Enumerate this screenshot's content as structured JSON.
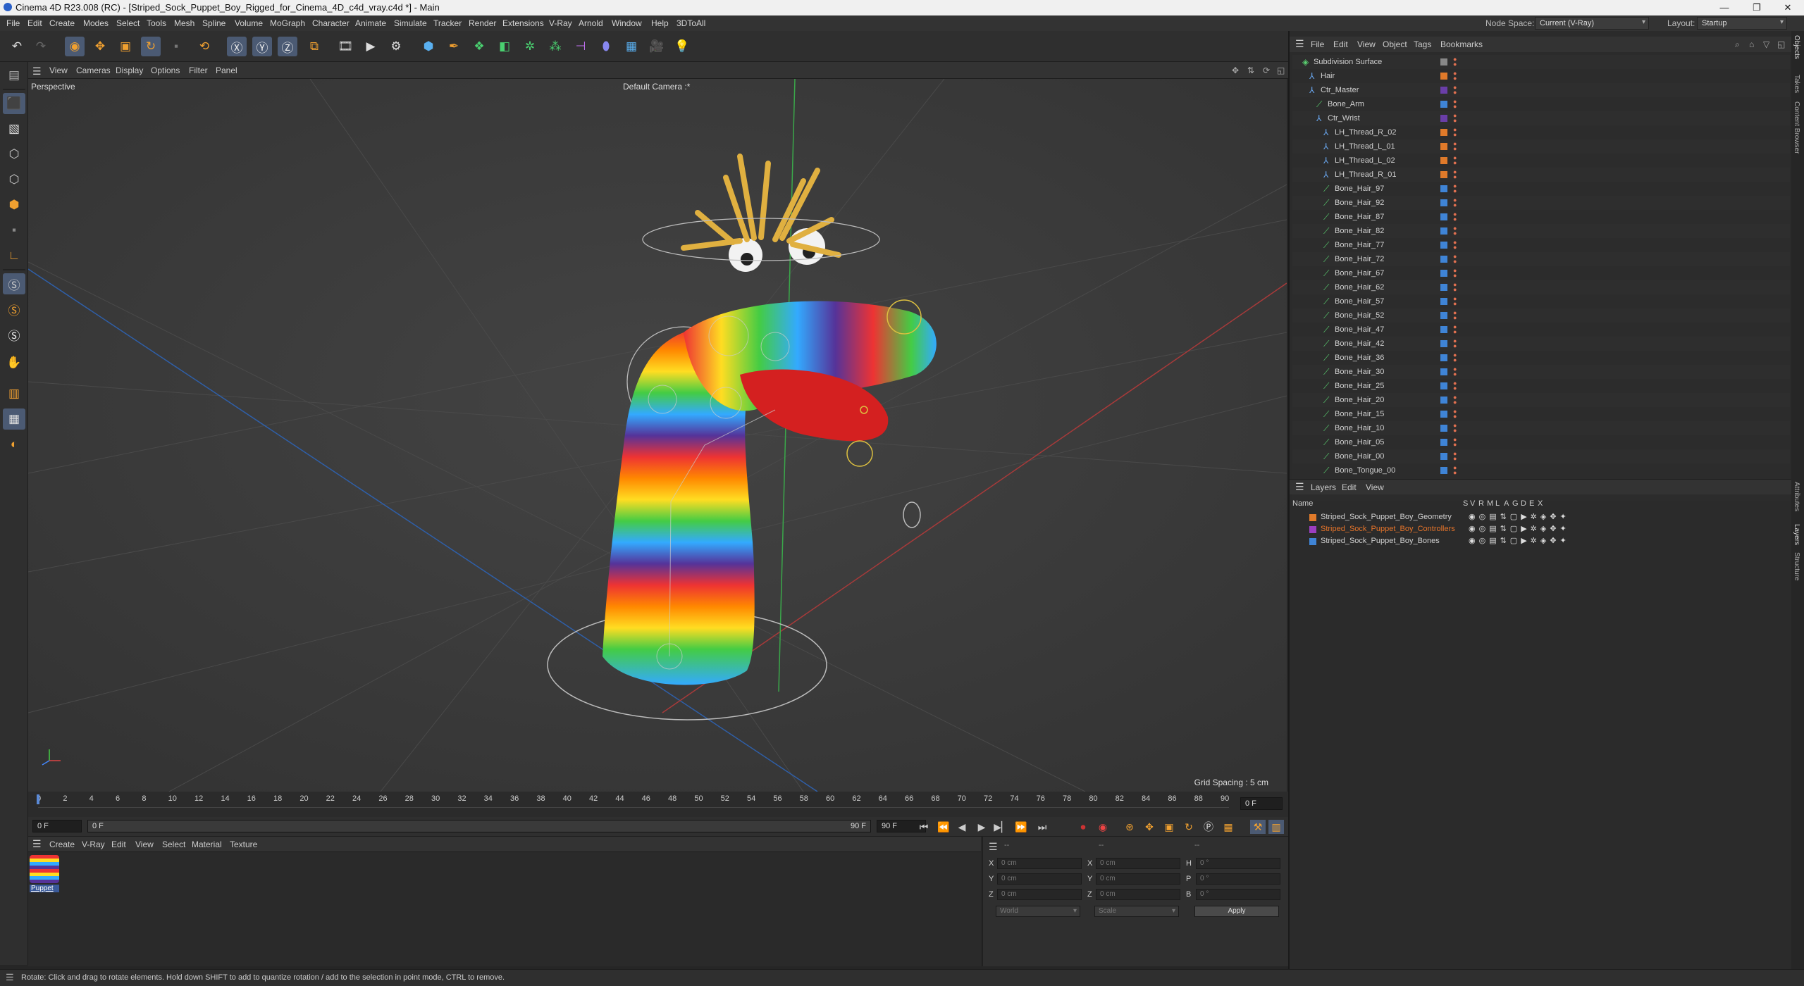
{
  "window": {
    "title": "Cinema 4D R23.008 (RC) - [Striped_Sock_Puppet_Boy_Rigged_for_Cinema_4D_c4d_vray.c4d *] - Main",
    "controls": [
      "—",
      "❐",
      "✕"
    ]
  },
  "menubar": {
    "items": [
      "File",
      "Edit",
      "Create",
      "Modes",
      "Select",
      "Tools",
      "Mesh",
      "Spline",
      "Volume",
      "MoGraph",
      "Character",
      "Animate",
      "Simulate",
      "Tracker",
      "Render",
      "Extensions",
      "V-Ray",
      "Arnold",
      "Window",
      "Help",
      "3DToAll"
    ],
    "node_space_label": "Node Space:",
    "node_space_value": "Current (V-Ray)",
    "layout_label": "Layout:",
    "layout_value": "Startup"
  },
  "viewport": {
    "menu": [
      "View",
      "Cameras",
      "Display",
      "Options",
      "Filter",
      "Panel"
    ],
    "label": "Perspective",
    "camera": "Default Camera :*",
    "grid_spacing": "Grid Spacing : 5 cm"
  },
  "timeline": {
    "ticks": [
      "0",
      "2",
      "4",
      "6",
      "8",
      "10",
      "12",
      "14",
      "16",
      "18",
      "20",
      "22",
      "24",
      "26",
      "28",
      "30",
      "32",
      "34",
      "36",
      "38",
      "40",
      "42",
      "44",
      "46",
      "48",
      "50",
      "52",
      "54",
      "56",
      "58",
      "60",
      "62",
      "64",
      "66",
      "68",
      "70",
      "72",
      "74",
      "76",
      "78",
      "80",
      "82",
      "84",
      "86",
      "88",
      "90"
    ],
    "current_frame": "0 F",
    "start_field": "0 F",
    "range_start": "0 F",
    "range_end": "90 F",
    "end_field": "90 F"
  },
  "material_manager": {
    "menu": [
      "Create",
      "V-Ray",
      "Edit",
      "View",
      "Select",
      "Material",
      "Texture"
    ],
    "material_name": "Puppet"
  },
  "coordinates": {
    "header": [
      "--",
      "--",
      "--"
    ],
    "rows": [
      {
        "a": "X",
        "av": "0 cm",
        "b": "X",
        "bv": "0 cm",
        "c": "H",
        "cv": "0 °"
      },
      {
        "a": "Y",
        "av": "0 cm",
        "b": "Y",
        "bv": "0 cm",
        "c": "P",
        "cv": "0 °"
      },
      {
        "a": "Z",
        "av": "0 cm",
        "b": "Z",
        "bv": "0 cm",
        "c": "B",
        "cv": "0 °"
      }
    ],
    "world": "World",
    "scale": "Scale",
    "apply": "Apply"
  },
  "status": {
    "text": "Rotate: Click and drag to rotate elements. Hold down SHIFT to add to quantize rotation / add to the selection in point mode, CTRL to remove."
  },
  "object_manager": {
    "menu": [
      "File",
      "Edit",
      "View",
      "Object",
      "Tags",
      "Bookmarks"
    ],
    "objects": [
      {
        "name": "Subdivision Surface",
        "depth": 0,
        "color": "#888888",
        "icon": "subdiv-icon"
      },
      {
        "name": "Hair",
        "depth": 1,
        "color": "#e07a2a",
        "icon": "null-icon"
      },
      {
        "name": "Ctr_Master",
        "depth": 1,
        "color": "#6a3ea8",
        "icon": "null-icon"
      },
      {
        "name": "Bone_Arm",
        "depth": 2,
        "color": "#3f84d6",
        "icon": "bone-icon"
      },
      {
        "name": "Ctr_Wrist",
        "depth": 2,
        "color": "#6a3ea8",
        "icon": "null-icon"
      },
      {
        "name": "LH_Thread_R_02",
        "depth": 3,
        "color": "#e07a2a",
        "icon": "null-icon"
      },
      {
        "name": "LH_Thread_L_01",
        "depth": 3,
        "color": "#e07a2a",
        "icon": "null-icon"
      },
      {
        "name": "LH_Thread_L_02",
        "depth": 3,
        "color": "#e07a2a",
        "icon": "null-icon"
      },
      {
        "name": "LH_Thread_R_01",
        "depth": 3,
        "color": "#e07a2a",
        "icon": "null-icon"
      },
      {
        "name": "Bone_Hair_97",
        "depth": 3,
        "color": "#3f84d6",
        "icon": "bone-icon"
      },
      {
        "name": "Bone_Hair_92",
        "depth": 3,
        "color": "#3f84d6",
        "icon": "bone-icon"
      },
      {
        "name": "Bone_Hair_87",
        "depth": 3,
        "color": "#3f84d6",
        "icon": "bone-icon"
      },
      {
        "name": "Bone_Hair_82",
        "depth": 3,
        "color": "#3f84d6",
        "icon": "bone-icon"
      },
      {
        "name": "Bone_Hair_77",
        "depth": 3,
        "color": "#3f84d6",
        "icon": "bone-icon"
      },
      {
        "name": "Bone_Hair_72",
        "depth": 3,
        "color": "#3f84d6",
        "icon": "bone-icon"
      },
      {
        "name": "Bone_Hair_67",
        "depth": 3,
        "color": "#3f84d6",
        "icon": "bone-icon"
      },
      {
        "name": "Bone_Hair_62",
        "depth": 3,
        "color": "#3f84d6",
        "icon": "bone-icon"
      },
      {
        "name": "Bone_Hair_57",
        "depth": 3,
        "color": "#3f84d6",
        "icon": "bone-icon"
      },
      {
        "name": "Bone_Hair_52",
        "depth": 3,
        "color": "#3f84d6",
        "icon": "bone-icon"
      },
      {
        "name": "Bone_Hair_47",
        "depth": 3,
        "color": "#3f84d6",
        "icon": "bone-icon"
      },
      {
        "name": "Bone_Hair_42",
        "depth": 3,
        "color": "#3f84d6",
        "icon": "bone-icon"
      },
      {
        "name": "Bone_Hair_36",
        "depth": 3,
        "color": "#3f84d6",
        "icon": "bone-icon"
      },
      {
        "name": "Bone_Hair_30",
        "depth": 3,
        "color": "#3f84d6",
        "icon": "bone-icon"
      },
      {
        "name": "Bone_Hair_25",
        "depth": 3,
        "color": "#3f84d6",
        "icon": "bone-icon"
      },
      {
        "name": "Bone_Hair_20",
        "depth": 3,
        "color": "#3f84d6",
        "icon": "bone-icon"
      },
      {
        "name": "Bone_Hair_15",
        "depth": 3,
        "color": "#3f84d6",
        "icon": "bone-icon"
      },
      {
        "name": "Bone_Hair_10",
        "depth": 3,
        "color": "#3f84d6",
        "icon": "bone-icon"
      },
      {
        "name": "Bone_Hair_05",
        "depth": 3,
        "color": "#3f84d6",
        "icon": "bone-icon"
      },
      {
        "name": "Bone_Hair_00",
        "depth": 3,
        "color": "#3f84d6",
        "icon": "bone-icon"
      },
      {
        "name": "Bone_Tongue_00",
        "depth": 3,
        "color": "#3f84d6",
        "icon": "bone-icon"
      }
    ]
  },
  "layers": {
    "menu": [
      "Layers",
      "Edit",
      "View"
    ],
    "header": {
      "name": "Name",
      "flags": [
        "S",
        "V",
        "R",
        "M",
        "L",
        "A",
        "G",
        "D",
        "E",
        "X"
      ]
    },
    "items": [
      {
        "name": "Striped_Sock_Puppet_Boy_Geometry",
        "color": "#e07a2a",
        "text_color": "#d0d0d0"
      },
      {
        "name": "Striped_Sock_Puppet_Boy_Controllers",
        "color": "#9b3ec0",
        "text_color": "#e6742a"
      },
      {
        "name": "Striped_Sock_Puppet_Boy_Bones",
        "color": "#3f84d6",
        "text_color": "#d0d0d0"
      }
    ]
  },
  "side_tabs": [
    "Objects",
    "Takes",
    "Content Browser",
    "Attributes",
    "Layers",
    "Structure"
  ]
}
